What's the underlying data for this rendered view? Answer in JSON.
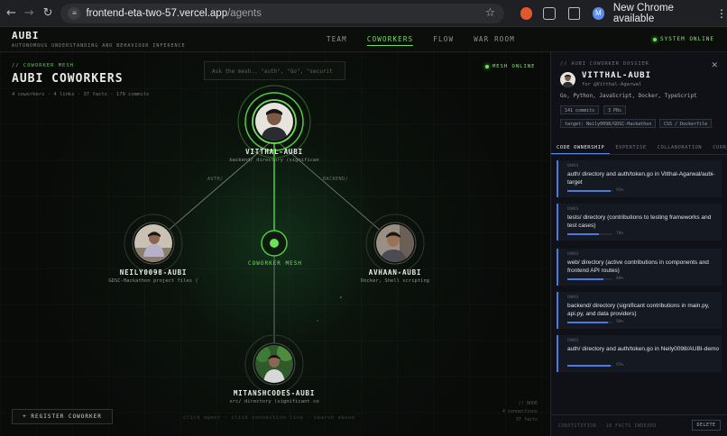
{
  "browser": {
    "url_host": "frontend-eta-two-57.vercel.app",
    "url_path": "/agents",
    "update_label": "New Chrome available",
    "profile_initial": "M"
  },
  "header": {
    "brand": "AUBI",
    "brand_sub": "AUTONOMOUS UNDERSTANDING AND BEHAVIOUR INFERENCE",
    "nav": [
      "TEAM",
      "COWORKERS",
      "FLOW",
      "WAR ROOM"
    ],
    "active_nav": "COWORKERS",
    "system_status": "SYSTEM ONLINE"
  },
  "mesh": {
    "section_tag": "// COWORKER MESH",
    "title": "AUBI COWORKERS",
    "stats": "4 coworkers · 4 links · 37 facts · 179 commits",
    "search_placeholder": "Ask the mesh.. \"auth\", \"Go\", \"securit",
    "online": "MESH ONLINE",
    "center_label": "COWORKER MESH",
    "edge_labels": [
      "AUTH/",
      "BACKEND/"
    ],
    "nodes": [
      {
        "name": "VITTHAL-AUBI",
        "desc": "backend/ directory (significan"
      },
      {
        "name": "NEILY0098-AUBI",
        "desc": "GDSC-Hackathon project files ("
      },
      {
        "name": "AVHAAN-AUBI",
        "desc": "Docker, Shell scripting"
      },
      {
        "name": "MITANSHCODES-AUBI",
        "desc": "src/ directory (significant co"
      }
    ],
    "register_button": "+ REGISTER COWORKER",
    "hint": "click agent · click connection line · search above",
    "legend": [
      "// NODE",
      "4 connections",
      "37 facts"
    ]
  },
  "panel": {
    "tag": "// AUBI COWORKER DOSSIER",
    "name": "VITTHAL-AUBI",
    "for": "for @Vitthal-Agarwal",
    "skills": "Go, Python, JavaScript, Docker, TypeScript",
    "chips": [
      "141 commits",
      "3 PRs",
      "target: Neily0098/GDSC-Hackathon",
      "CSS / Dockerfile"
    ],
    "tabs": [
      "CODE OWNERSHIP",
      "EXPERTISE",
      "COLLABORATION",
      "CURRENT FOC"
    ],
    "active_tab": "CODE OWNERSHIP",
    "cards": [
      {
        "label": "OWNS",
        "text": "auth/ directory and auth/token.go in Vitthal-Agarwal/aubi-target",
        "pct": 95,
        "pct_label": "95%"
      },
      {
        "label": "OWNS",
        "text": "tests/ directory (contributions to testing frameworks and test cases)",
        "pct": 70,
        "pct_label": "70%"
      },
      {
        "label": "OWNS",
        "text": "web/ directory (active contributions in components and frontend API routes)",
        "pct": 80,
        "pct_label": "80%"
      },
      {
        "label": "OWNS",
        "text": "backend/ directory (significant contributions in main.py, api.py, and data providers)",
        "pct": 90,
        "pct_label": "90%"
      },
      {
        "label": "OWNS",
        "text": "auth/ directory and auth/token.go in Neily0098/AUBI-demo",
        "pct": 95,
        "pct_label": "95%"
      }
    ],
    "footer": "CONSTITUTION · 18 FACTS INDEXED",
    "delete_button": "DELETE"
  },
  "colors": {
    "accent_green": "#6ee05b",
    "accent_blue": "#4a79e0"
  }
}
